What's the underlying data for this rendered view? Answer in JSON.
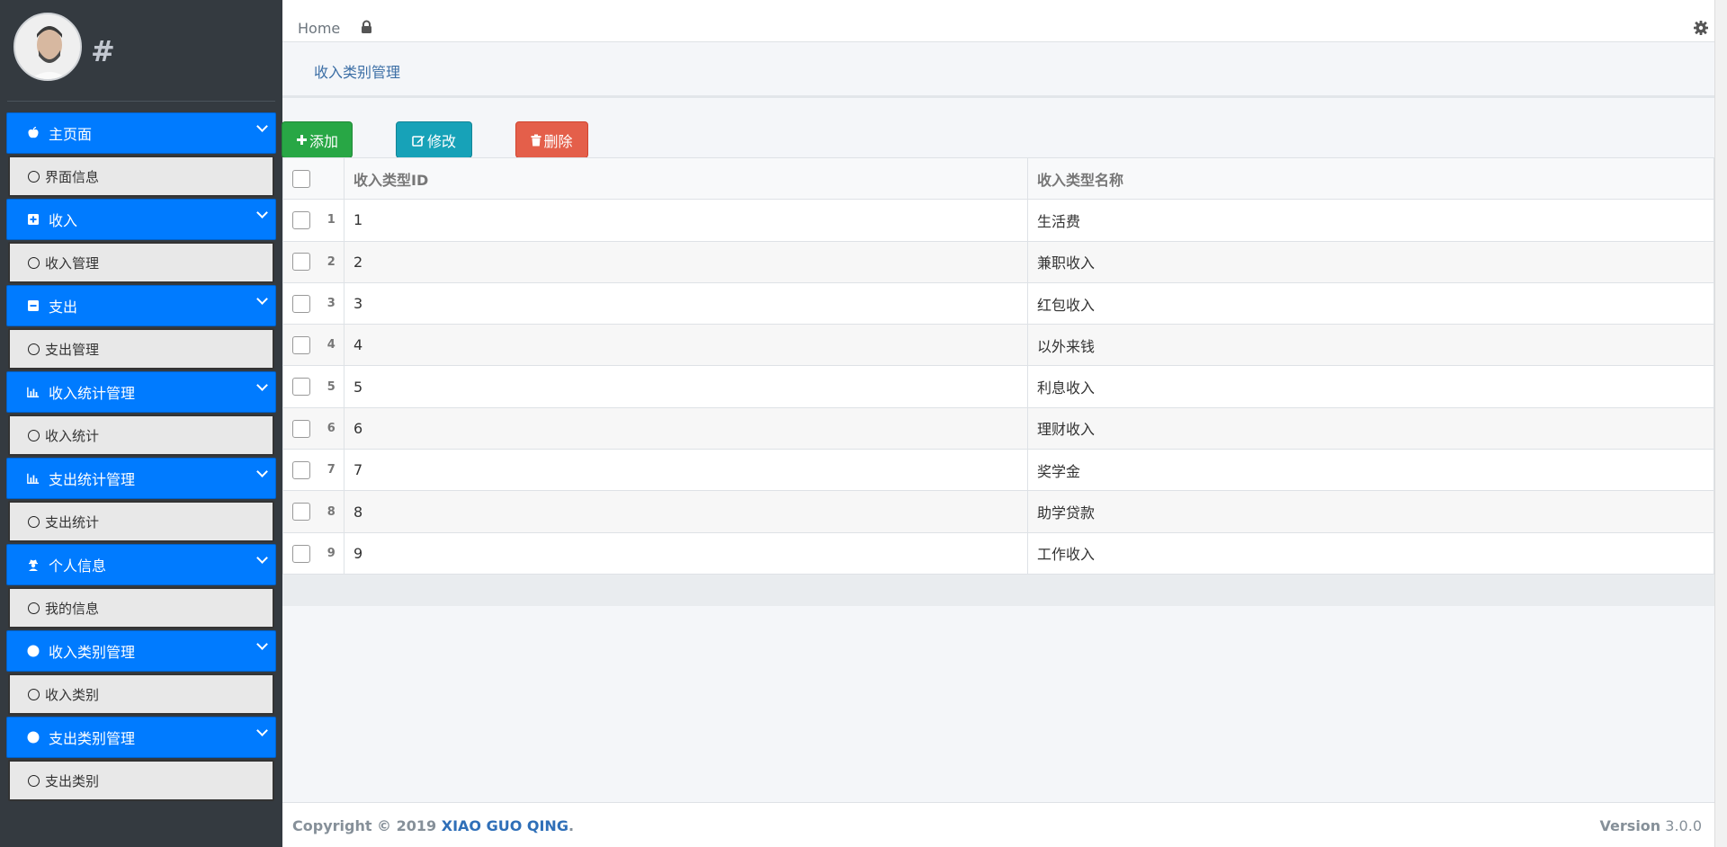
{
  "brand": {
    "title": "#"
  },
  "topnav": {
    "home_label": "Home"
  },
  "breadcrumb": {
    "label": "收入类别管理"
  },
  "sidebar": {
    "groups": [
      {
        "label": "主页面",
        "icon": "apple-icon",
        "item": "界面信息"
      },
      {
        "label": "收入",
        "icon": "plus-square-icon",
        "item": "收入管理"
      },
      {
        "label": "支出",
        "icon": "minus-square-icon",
        "item": "支出管理"
      },
      {
        "label": "收入统计管理",
        "icon": "bar-chart-icon",
        "item": "收入统计"
      },
      {
        "label": "支出统计管理",
        "icon": "bar-chart-icon",
        "item": "支出统计"
      },
      {
        "label": "个人信息",
        "icon": "user-secret-icon",
        "item": "我的信息"
      },
      {
        "label": "收入类别管理",
        "icon": "circle-icon",
        "item": "收入类别"
      },
      {
        "label": "支出类别管理",
        "icon": "circle-icon",
        "item": "支出类别"
      }
    ]
  },
  "toolbar": {
    "add_label": "添加",
    "edit_label": "修改",
    "delete_label": "删除"
  },
  "table": {
    "headers": {
      "id": "收入类型ID",
      "name": "收入类型名称"
    },
    "rows": [
      {
        "num": "1",
        "id": "1",
        "name": "生活费"
      },
      {
        "num": "2",
        "id": "2",
        "name": "兼职收入"
      },
      {
        "num": "3",
        "id": "3",
        "name": "红包收入"
      },
      {
        "num": "4",
        "id": "4",
        "name": "以外来钱"
      },
      {
        "num": "5",
        "id": "5",
        "name": "利息收入"
      },
      {
        "num": "6",
        "id": "6",
        "name": "理财收入"
      },
      {
        "num": "7",
        "id": "7",
        "name": "奖学金"
      },
      {
        "num": "8",
        "id": "8",
        "name": "助学贷款"
      },
      {
        "num": "9",
        "id": "9",
        "name": "工作收入"
      }
    ]
  },
  "footer": {
    "copyright_prefix": "Copyright © 2019 ",
    "owner": "XIAO GUO QING",
    "suffix": ".",
    "version_label": "Version",
    "version_number": "3.0.0"
  },
  "colors": {
    "primary": "#007bff",
    "success": "#28a745",
    "info": "#17a2b8",
    "danger": "#e45f4a",
    "sidebar_bg": "#343a40"
  }
}
